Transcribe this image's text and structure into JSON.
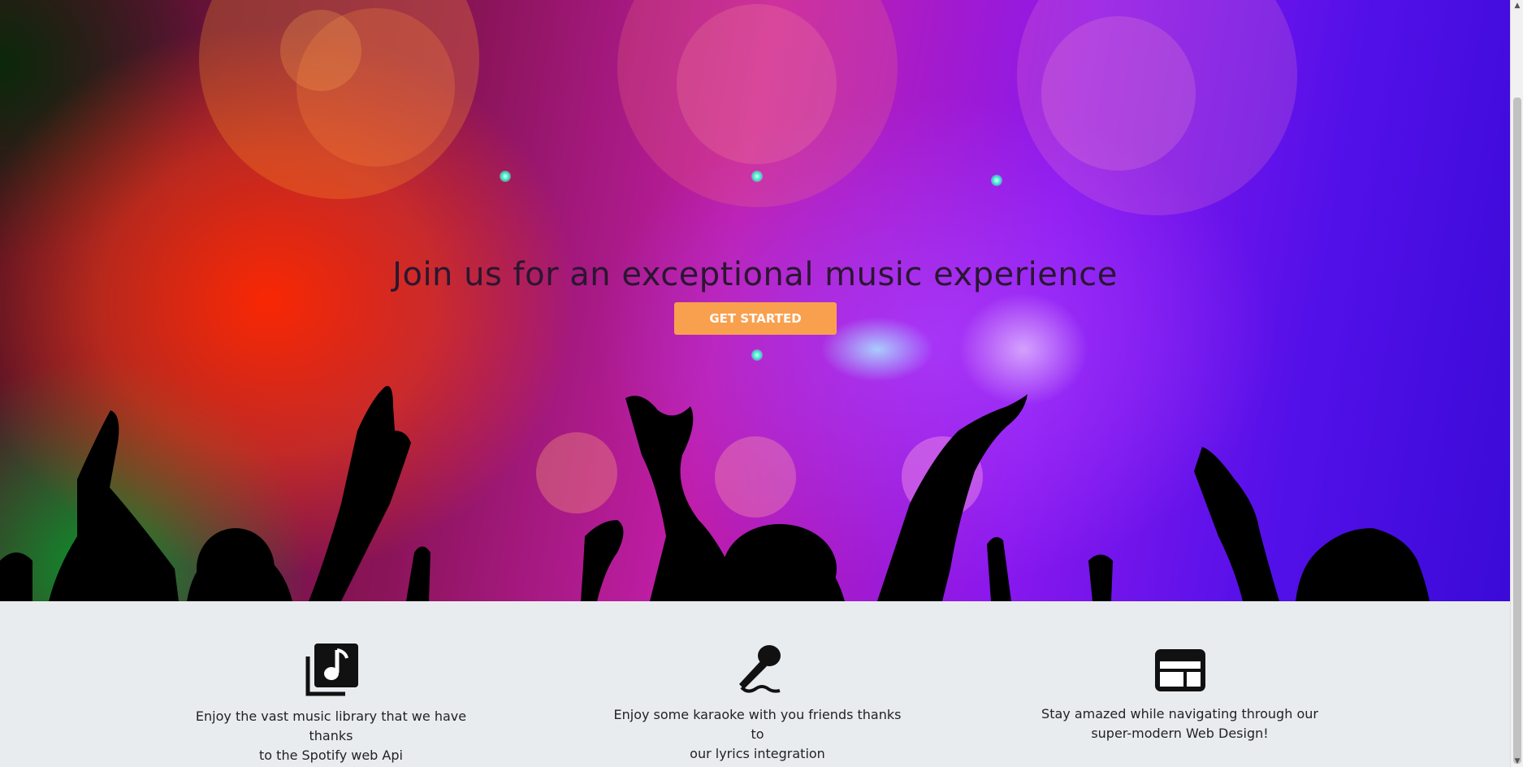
{
  "hero": {
    "title": "Join us for an exceptional music experience",
    "cta_label": "GET STARTED"
  },
  "features": [
    {
      "icon": "music-library-icon",
      "text_line1": "Enjoy the vast music library that we have thanks",
      "text_line2": "to the Spotify web Api"
    },
    {
      "icon": "microphone-icon",
      "text_line1": "Enjoy some karaoke with you friends thanks to",
      "text_line2": "our lyrics integration"
    },
    {
      "icon": "web-layout-icon",
      "text_line1": "Stay amazed while navigating through our",
      "text_line2": "super-modern Web Design!"
    }
  ],
  "colors": {
    "accent": "#f9a04f",
    "features_background": "#e9ecef"
  }
}
